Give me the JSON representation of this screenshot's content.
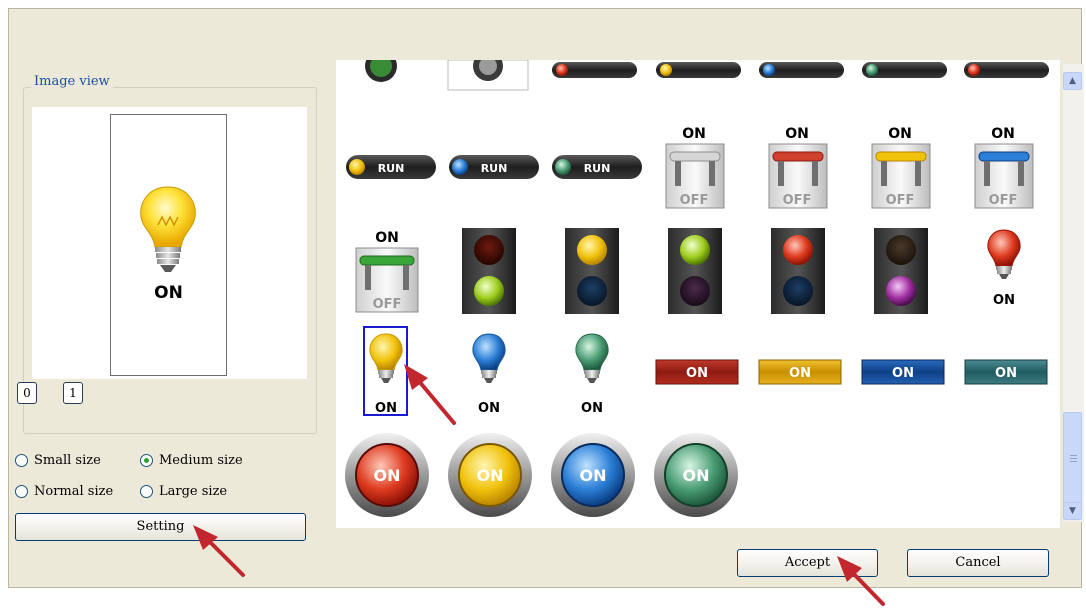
{
  "image_view": {
    "legend": "Image view",
    "preview_text": "ON",
    "state_buttons": [
      "0",
      "1"
    ]
  },
  "sizes": {
    "small": "Small size",
    "medium": "Medium size",
    "normal": "Normal size",
    "large": "Large size",
    "selected": "Medium size"
  },
  "buttons": {
    "setting": "Setting",
    "accept": "Accept",
    "cancel": "Cancel"
  },
  "gallery": {
    "run_label": "RUN",
    "switch_on": "ON",
    "switch_off": "OFF",
    "bar_on": "ON",
    "round_on": "ON",
    "bulb_on": "ON",
    "selected_item": "yellow bulb"
  },
  "colors": {
    "dialog_bg": "#ece9d8",
    "selection_border": "#1a1ad0",
    "arrow": "#c1272d",
    "red": "#d82b1e",
    "yellow": "#f2c315",
    "blue": "#1f63c6",
    "green": "#3f8f64"
  }
}
